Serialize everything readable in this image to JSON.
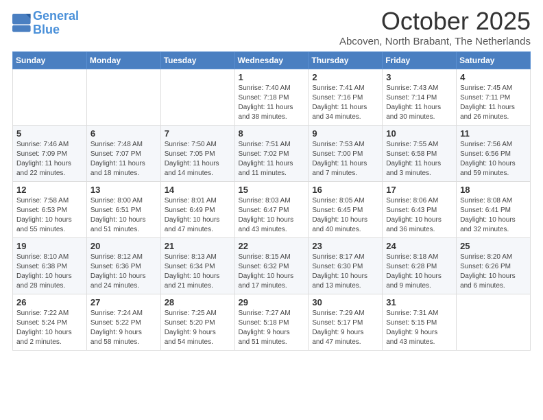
{
  "header": {
    "logo_line1": "General",
    "logo_line2": "Blue",
    "month": "October 2025",
    "location": "Abcoven, North Brabant, The Netherlands"
  },
  "weekdays": [
    "Sunday",
    "Monday",
    "Tuesday",
    "Wednesday",
    "Thursday",
    "Friday",
    "Saturday"
  ],
  "weeks": [
    [
      {
        "day": "",
        "info": ""
      },
      {
        "day": "",
        "info": ""
      },
      {
        "day": "",
        "info": ""
      },
      {
        "day": "1",
        "info": "Sunrise: 7:40 AM\nSunset: 7:18 PM\nDaylight: 11 hours\nand 38 minutes."
      },
      {
        "day": "2",
        "info": "Sunrise: 7:41 AM\nSunset: 7:16 PM\nDaylight: 11 hours\nand 34 minutes."
      },
      {
        "day": "3",
        "info": "Sunrise: 7:43 AM\nSunset: 7:14 PM\nDaylight: 11 hours\nand 30 minutes."
      },
      {
        "day": "4",
        "info": "Sunrise: 7:45 AM\nSunset: 7:11 PM\nDaylight: 11 hours\nand 26 minutes."
      }
    ],
    [
      {
        "day": "5",
        "info": "Sunrise: 7:46 AM\nSunset: 7:09 PM\nDaylight: 11 hours\nand 22 minutes."
      },
      {
        "day": "6",
        "info": "Sunrise: 7:48 AM\nSunset: 7:07 PM\nDaylight: 11 hours\nand 18 minutes."
      },
      {
        "day": "7",
        "info": "Sunrise: 7:50 AM\nSunset: 7:05 PM\nDaylight: 11 hours\nand 14 minutes."
      },
      {
        "day": "8",
        "info": "Sunrise: 7:51 AM\nSunset: 7:02 PM\nDaylight: 11 hours\nand 11 minutes."
      },
      {
        "day": "9",
        "info": "Sunrise: 7:53 AM\nSunset: 7:00 PM\nDaylight: 11 hours\nand 7 minutes."
      },
      {
        "day": "10",
        "info": "Sunrise: 7:55 AM\nSunset: 6:58 PM\nDaylight: 11 hours\nand 3 minutes."
      },
      {
        "day": "11",
        "info": "Sunrise: 7:56 AM\nSunset: 6:56 PM\nDaylight: 10 hours\nand 59 minutes."
      }
    ],
    [
      {
        "day": "12",
        "info": "Sunrise: 7:58 AM\nSunset: 6:53 PM\nDaylight: 10 hours\nand 55 minutes."
      },
      {
        "day": "13",
        "info": "Sunrise: 8:00 AM\nSunset: 6:51 PM\nDaylight: 10 hours\nand 51 minutes."
      },
      {
        "day": "14",
        "info": "Sunrise: 8:01 AM\nSunset: 6:49 PM\nDaylight: 10 hours\nand 47 minutes."
      },
      {
        "day": "15",
        "info": "Sunrise: 8:03 AM\nSunset: 6:47 PM\nDaylight: 10 hours\nand 43 minutes."
      },
      {
        "day": "16",
        "info": "Sunrise: 8:05 AM\nSunset: 6:45 PM\nDaylight: 10 hours\nand 40 minutes."
      },
      {
        "day": "17",
        "info": "Sunrise: 8:06 AM\nSunset: 6:43 PM\nDaylight: 10 hours\nand 36 minutes."
      },
      {
        "day": "18",
        "info": "Sunrise: 8:08 AM\nSunset: 6:41 PM\nDaylight: 10 hours\nand 32 minutes."
      }
    ],
    [
      {
        "day": "19",
        "info": "Sunrise: 8:10 AM\nSunset: 6:38 PM\nDaylight: 10 hours\nand 28 minutes."
      },
      {
        "day": "20",
        "info": "Sunrise: 8:12 AM\nSunset: 6:36 PM\nDaylight: 10 hours\nand 24 minutes."
      },
      {
        "day": "21",
        "info": "Sunrise: 8:13 AM\nSunset: 6:34 PM\nDaylight: 10 hours\nand 21 minutes."
      },
      {
        "day": "22",
        "info": "Sunrise: 8:15 AM\nSunset: 6:32 PM\nDaylight: 10 hours\nand 17 minutes."
      },
      {
        "day": "23",
        "info": "Sunrise: 8:17 AM\nSunset: 6:30 PM\nDaylight: 10 hours\nand 13 minutes."
      },
      {
        "day": "24",
        "info": "Sunrise: 8:18 AM\nSunset: 6:28 PM\nDaylight: 10 hours\nand 9 minutes."
      },
      {
        "day": "25",
        "info": "Sunrise: 8:20 AM\nSunset: 6:26 PM\nDaylight: 10 hours\nand 6 minutes."
      }
    ],
    [
      {
        "day": "26",
        "info": "Sunrise: 7:22 AM\nSunset: 5:24 PM\nDaylight: 10 hours\nand 2 minutes."
      },
      {
        "day": "27",
        "info": "Sunrise: 7:24 AM\nSunset: 5:22 PM\nDaylight: 9 hours\nand 58 minutes."
      },
      {
        "day": "28",
        "info": "Sunrise: 7:25 AM\nSunset: 5:20 PM\nDaylight: 9 hours\nand 54 minutes."
      },
      {
        "day": "29",
        "info": "Sunrise: 7:27 AM\nSunset: 5:18 PM\nDaylight: 9 hours\nand 51 minutes."
      },
      {
        "day": "30",
        "info": "Sunrise: 7:29 AM\nSunset: 5:17 PM\nDaylight: 9 hours\nand 47 minutes."
      },
      {
        "day": "31",
        "info": "Sunrise: 7:31 AM\nSunset: 5:15 PM\nDaylight: 9 hours\nand 43 minutes."
      },
      {
        "day": "",
        "info": ""
      }
    ]
  ]
}
